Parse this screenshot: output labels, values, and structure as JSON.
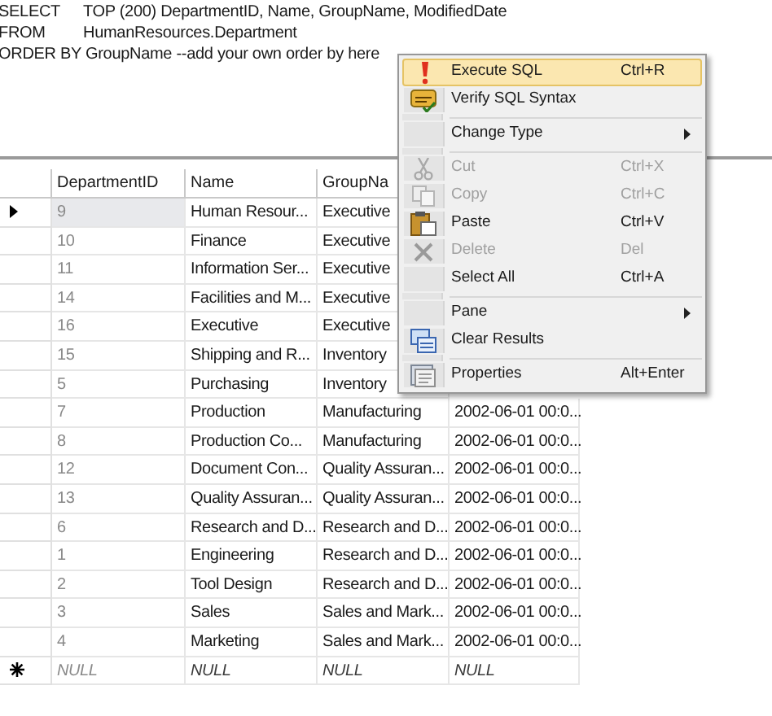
{
  "sql_pane": {
    "lines": [
      {
        "keyword": "SELECT",
        "text": "TOP (200) DepartmentID, Name, GroupName, ModifiedDate"
      },
      {
        "keyword": "FROM",
        "text": "HumanResources.Department"
      },
      {
        "text": "ORDER BY GroupName --add your own order by here"
      }
    ]
  },
  "results_grid": {
    "columns": [
      "DepartmentID",
      "Name",
      "GroupNa"
    ],
    "rows": [
      {
        "current": true,
        "cells": [
          "9",
          "Human Resour...",
          "Executive"
        ]
      },
      {
        "current": false,
        "cells": [
          "10",
          "Finance",
          "Executive"
        ]
      },
      {
        "current": false,
        "cells": [
          "11",
          "Information Ser...",
          "Executive"
        ]
      },
      {
        "current": false,
        "cells": [
          "14",
          "Facilities and M...",
          "Executive"
        ]
      },
      {
        "current": false,
        "cells": [
          "16",
          "Executive",
          "Executive"
        ]
      },
      {
        "current": false,
        "cells": [
          "15",
          "Shipping and R...",
          "Inventory"
        ]
      },
      {
        "current": false,
        "cells": [
          "5",
          "Purchasing",
          "Inventory"
        ]
      },
      {
        "current": false,
        "cells": [
          "7",
          "Production",
          "Manufacturing",
          "2002-06-01 00:0..."
        ]
      },
      {
        "current": false,
        "cells": [
          "8",
          "Production Co...",
          "Manufacturing",
          "2002-06-01 00:0..."
        ]
      },
      {
        "current": false,
        "cells": [
          "12",
          "Document Con...",
          "Quality Assuran...",
          "2002-06-01 00:0..."
        ]
      },
      {
        "current": false,
        "cells": [
          "13",
          "Quality Assuran...",
          "Quality Assuran...",
          "2002-06-01 00:0..."
        ]
      },
      {
        "current": false,
        "cells": [
          "6",
          "Research and D...",
          "Research and D...",
          "2002-06-01 00:0..."
        ]
      },
      {
        "current": false,
        "cells": [
          "1",
          "Engineering",
          "Research and D...",
          "2002-06-01 00:0..."
        ]
      },
      {
        "current": false,
        "cells": [
          "2",
          "Tool Design",
          "Research and D...",
          "2002-06-01 00:0..."
        ]
      },
      {
        "current": false,
        "cells": [
          "3",
          "Sales",
          "Sales and Mark...",
          "2002-06-01 00:0..."
        ]
      },
      {
        "current": false,
        "cells": [
          "4",
          "Marketing",
          "Sales and Mark...",
          "2002-06-01 00:0..."
        ]
      },
      {
        "kind": "new",
        "current": false,
        "cells": [
          "NULL",
          "NULL",
          "NULL",
          "NULL"
        ]
      }
    ]
  },
  "context_menu": {
    "items": [
      {
        "kind": "command",
        "label": "Execute SQL",
        "shortcut": "Ctrl+R",
        "selected": true,
        "disabled": false
      },
      {
        "kind": "command",
        "label": "Verify SQL Syntax",
        "selected": false,
        "disabled": false
      },
      {
        "kind": "separator"
      },
      {
        "kind": "submenu",
        "label": "Change Type",
        "selected": false,
        "disabled": false
      },
      {
        "kind": "separator"
      },
      {
        "kind": "command",
        "label": "Cut",
        "shortcut": "Ctrl+X",
        "selected": false,
        "disabled": true
      },
      {
        "kind": "command",
        "label": "Copy",
        "shortcut": "Ctrl+C",
        "selected": false,
        "disabled": true
      },
      {
        "kind": "command",
        "label": "Paste",
        "shortcut": "Ctrl+V",
        "selected": false,
        "disabled": false
      },
      {
        "kind": "command",
        "label": "Delete",
        "shortcut": "Del",
        "selected": false,
        "disabled": true
      },
      {
        "kind": "command",
        "label": "Select All",
        "shortcut": "Ctrl+A",
        "selected": false,
        "disabled": false
      },
      {
        "kind": "separator"
      },
      {
        "kind": "submenu",
        "label": "Pane",
        "selected": false,
        "disabled": false
      },
      {
        "kind": "command",
        "label": "Clear Results",
        "selected": false,
        "disabled": false
      },
      {
        "kind": "separator"
      },
      {
        "kind": "command",
        "label": "Properties",
        "shortcut": "Alt+Enter",
        "selected": false,
        "disabled": false
      }
    ]
  }
}
